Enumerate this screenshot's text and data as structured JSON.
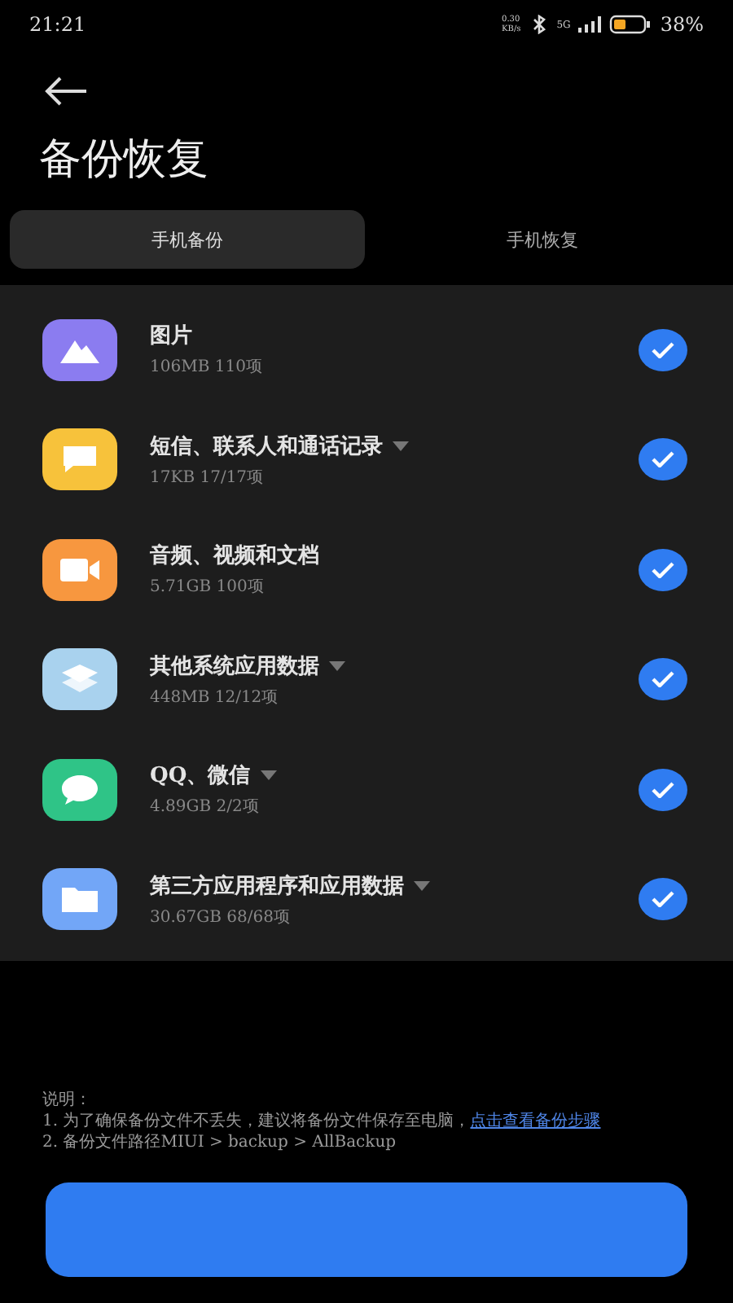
{
  "status_bar": {
    "time": "21:21",
    "net_speed": [
      "0.30",
      "KB/s"
    ],
    "network": "5G",
    "battery": "38%"
  },
  "title": "备份恢复",
  "tabs": [
    {
      "label": "手机备份",
      "selected": true
    },
    {
      "label": "手机恢复",
      "selected": false
    }
  ],
  "items": [
    {
      "kind": "photos",
      "color": "#8b7cf0",
      "name": "图片",
      "detail": "106MB  110项",
      "expandable": false,
      "checked": true
    },
    {
      "kind": "messages",
      "color": "#f7c23b",
      "name": "短信、联系人和通话记录",
      "detail": "17KB  17/17项",
      "expandable": true,
      "checked": true
    },
    {
      "kind": "media",
      "color": "#f7973f",
      "name": "音频、视频和文档",
      "detail": "5.71GB  100项",
      "expandable": false,
      "checked": true
    },
    {
      "kind": "system",
      "color": "#a9d2ee",
      "name": "其他系统应用数据",
      "detail": "448MB  12/12项",
      "expandable": true,
      "checked": true
    },
    {
      "kind": "chat",
      "color": "#2fc487",
      "name": "QQ、微信",
      "detail": "4.89GB  2/2项",
      "expandable": true,
      "checked": true
    },
    {
      "kind": "apps",
      "color": "#72a6f7",
      "name": "第三方应用程序和应用数据",
      "detail": "30.67GB  68/68项",
      "expandable": true,
      "checked": true
    }
  ],
  "notes": {
    "heading": "说明：",
    "line_1": "1. 为了确保备份文件不丢失，建议将备份文件保存至电脑，",
    "link": "点击查看备份步骤",
    "line_2": "2. 备份文件路径MIUI > backup > AllBackup"
  }
}
